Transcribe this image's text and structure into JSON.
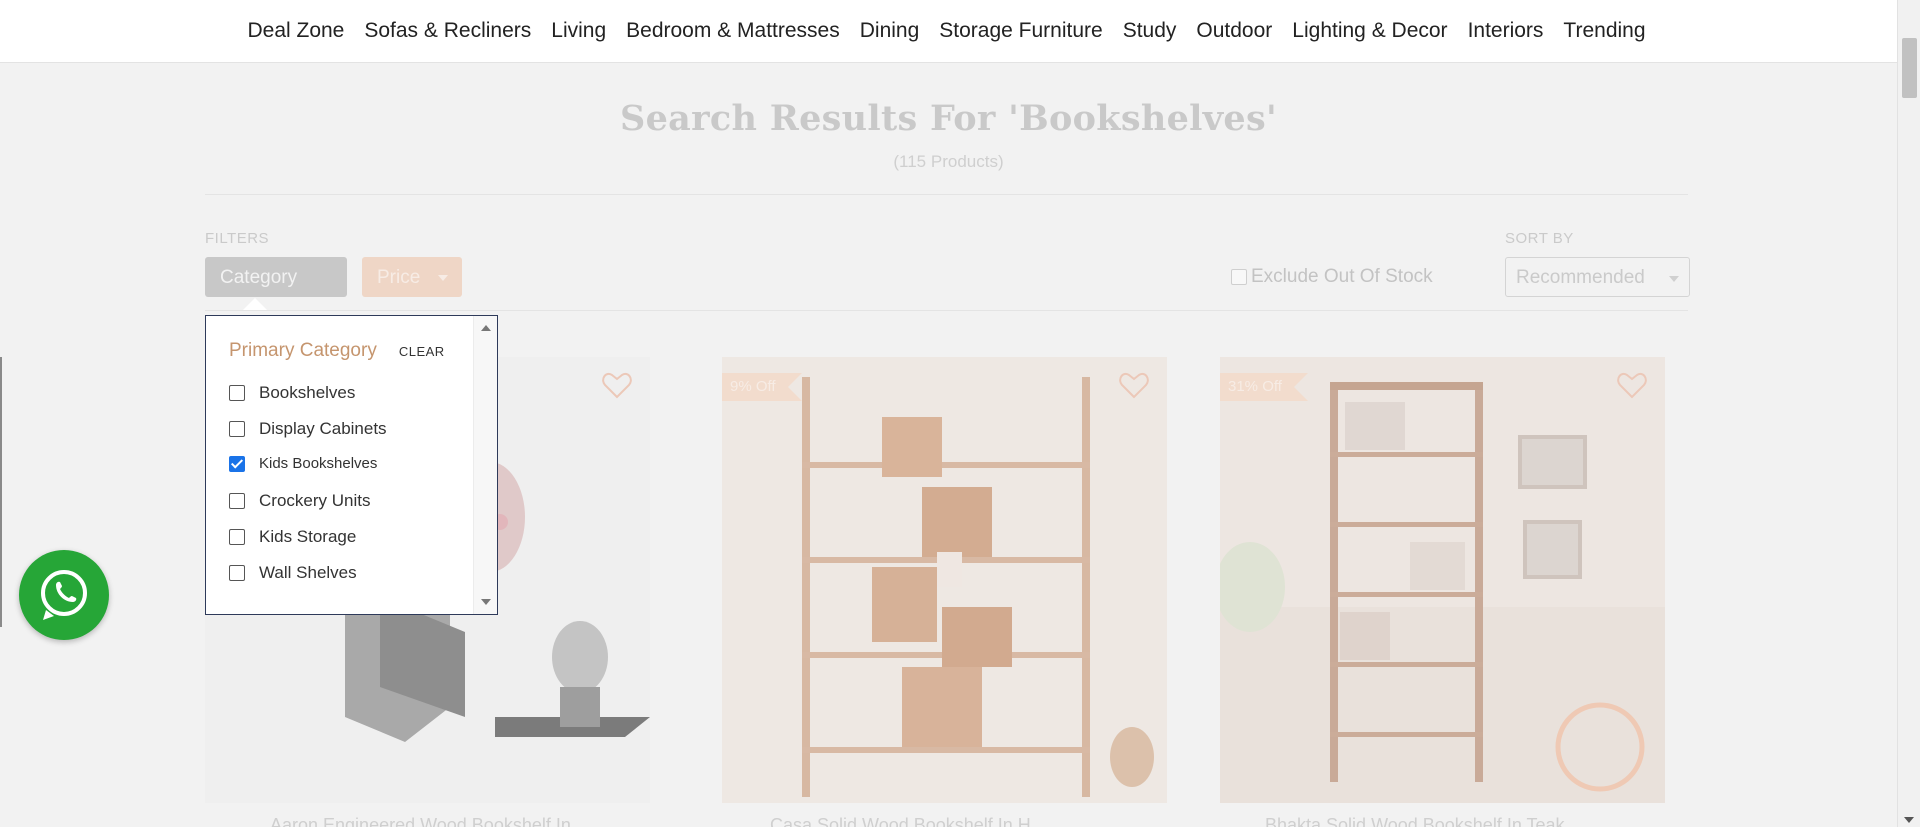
{
  "nav": {
    "items": [
      "Deal Zone",
      "Sofas & Recliners",
      "Living",
      "Bedroom & Mattresses",
      "Dining",
      "Storage Furniture",
      "Study",
      "Outdoor",
      "Lighting & Decor",
      "Interiors",
      "Trending"
    ]
  },
  "search": {
    "title": "Search Results For 'Bookshelves'",
    "count": "(115 Products)"
  },
  "filters": {
    "label": "FILTERS",
    "category_button": "Category",
    "price_button": "Price",
    "exclude_out_of_stock": "Exclude Out Of Stock",
    "sort_label": "SORT BY",
    "sort_value": "Recommended"
  },
  "category_panel": {
    "title": "Primary Category",
    "clear": "CLEAR",
    "options": [
      {
        "label": "Bookshelves",
        "checked": false
      },
      {
        "label": "Display Cabinets",
        "checked": false
      },
      {
        "label": "Kids Bookshelves",
        "checked": true
      },
      {
        "label": "Crockery Units",
        "checked": false
      },
      {
        "label": "Kids Storage",
        "checked": false
      },
      {
        "label": "Wall Shelves",
        "checked": false
      }
    ]
  },
  "products": [
    {
      "badge": "",
      "title": "Aaron Engineered Wood Bookshelf In"
    },
    {
      "badge": "9% Off",
      "title": "Casa Solid Wood Bookshelf In H"
    },
    {
      "badge": "31% Off",
      "title": "Bhakta Solid Wood Bookshelf In Teak"
    }
  ],
  "colors": {
    "accent": "#c5956e",
    "checkbox": "#1a73e8",
    "whatsapp": "#26a637"
  }
}
